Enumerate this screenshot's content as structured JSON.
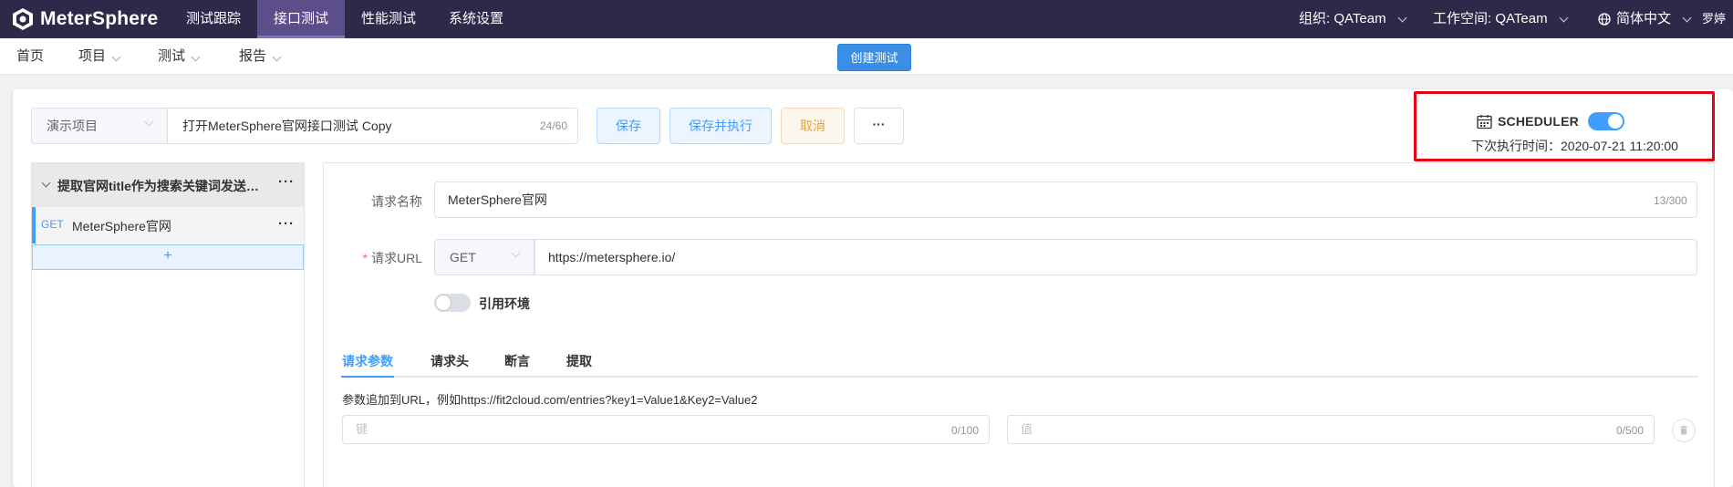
{
  "header": {
    "brand": "MeterSphere",
    "nav": [
      {
        "label": "测试跟踪",
        "active": false
      },
      {
        "label": "接口测试",
        "active": true
      },
      {
        "label": "性能测试",
        "active": false
      },
      {
        "label": "系统设置",
        "active": false
      }
    ],
    "org": "组织: QATeam",
    "workspace": "工作空间: QATeam",
    "language": "简体中文",
    "user": "罗婷"
  },
  "subnav": {
    "items": [
      "首页",
      "项目",
      "测试",
      "报告"
    ],
    "create_button": "创建测试"
  },
  "toolbar": {
    "project_select": "演示项目",
    "test_name": "打开MeterSphere官网接口测试 Copy",
    "test_name_count": "24/60",
    "save": "保存",
    "save_and_run": "保存并执行",
    "cancel": "取消",
    "more": "···"
  },
  "scheduler": {
    "label": "SCHEDULER",
    "enabled": true,
    "next_run_label": "下次执行时间：",
    "next_run_time": "2020-07-21 11:20:00"
  },
  "scenario": {
    "title": "提取官网title作为搜索关键词发送…",
    "more": "···",
    "requests": [
      {
        "method": "GET",
        "name": "MeterSphere官网",
        "more": "···"
      }
    ],
    "add": "+"
  },
  "request_form": {
    "name_label": "请求名称",
    "name_value": "MeterSphere官网",
    "name_count": "13/300",
    "url_required": "*",
    "url_label": "请求URL",
    "method": "GET",
    "url_value": "https://metersphere.io/",
    "env_toggle_on": false,
    "env_label": "引用环境",
    "tabs": [
      "请求参数",
      "请求头",
      "断言",
      "提取"
    ],
    "active_tab": "请求参数",
    "hint": "参数追加到URL，例如https://fit2cloud.com/entries?key1=Value1&Key2=Value2",
    "key_placeholder": "键",
    "key_count": "0/100",
    "value_placeholder": "值",
    "value_count": "0/500"
  },
  "colors": {
    "header_bg": "#2c2a48",
    "active_nav": "#5b4e8b",
    "primary": "#409eff",
    "warning": "#e6a23c",
    "highlight_border": "#e60012"
  }
}
